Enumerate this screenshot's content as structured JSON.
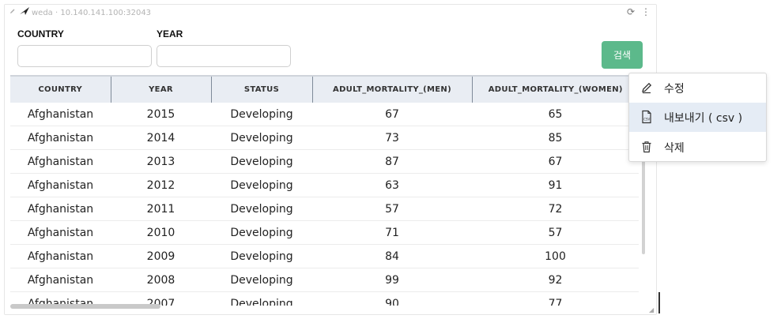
{
  "header": {
    "source": "weda · 10.140.141.100:32043",
    "refresh_glyph": "⟳",
    "more_glyph": "⋮"
  },
  "filters": {
    "country_label": "COUNTRY",
    "country_value": "",
    "year_label": "YEAR",
    "year_value": ""
  },
  "search_button_label": "검색",
  "table": {
    "columns": [
      "COUNTRY",
      "YEAR",
      "STATUS",
      "ADULT_MORTALITY_(MEN)",
      "ADULT_MORTALITY_(WOMEN)"
    ],
    "rows": [
      [
        "Afghanistan",
        "2015",
        "Developing",
        "67",
        "65"
      ],
      [
        "Afghanistan",
        "2014",
        "Developing",
        "73",
        "85"
      ],
      [
        "Afghanistan",
        "2013",
        "Developing",
        "87",
        "67"
      ],
      [
        "Afghanistan",
        "2012",
        "Developing",
        "63",
        "91"
      ],
      [
        "Afghanistan",
        "2011",
        "Developing",
        "57",
        "72"
      ],
      [
        "Afghanistan",
        "2010",
        "Developing",
        "71",
        "57"
      ],
      [
        "Afghanistan",
        "2009",
        "Developing",
        "84",
        "100"
      ],
      [
        "Afghanistan",
        "2008",
        "Developing",
        "99",
        "92"
      ],
      [
        "Afghanistan",
        "2007",
        "Developing",
        "90",
        "77"
      ]
    ]
  },
  "menu": {
    "items": [
      {
        "label": "수정",
        "icon": "pencil-icon"
      },
      {
        "label": "내보내기 ( csv )",
        "icon": "csv-file-icon"
      },
      {
        "label": "삭제",
        "icon": "trash-icon"
      }
    ]
  },
  "colors": {
    "search_button": "#5cb98b",
    "table_header_bg": "#e9edf3",
    "menu_active_bg": "#e5ecf5"
  }
}
